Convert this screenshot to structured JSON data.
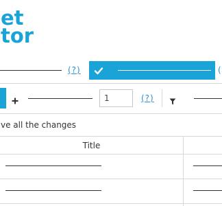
{
  "logo": {
    "line1": "et",
    "line2": "tor",
    "color": "#1aa3d6"
  },
  "row1": {
    "help_label": "(?)",
    "confirm_icon": "check-icon",
    "help_label_right": "("
  },
  "toolbar": {
    "add_icon": "plus-icon",
    "quantity_value": "1",
    "help_label": "(?)",
    "filter_icon": "filter-icon"
  },
  "message": "ve all the changes",
  "table": {
    "headers": [
      "Title"
    ],
    "row_count": 2
  }
}
